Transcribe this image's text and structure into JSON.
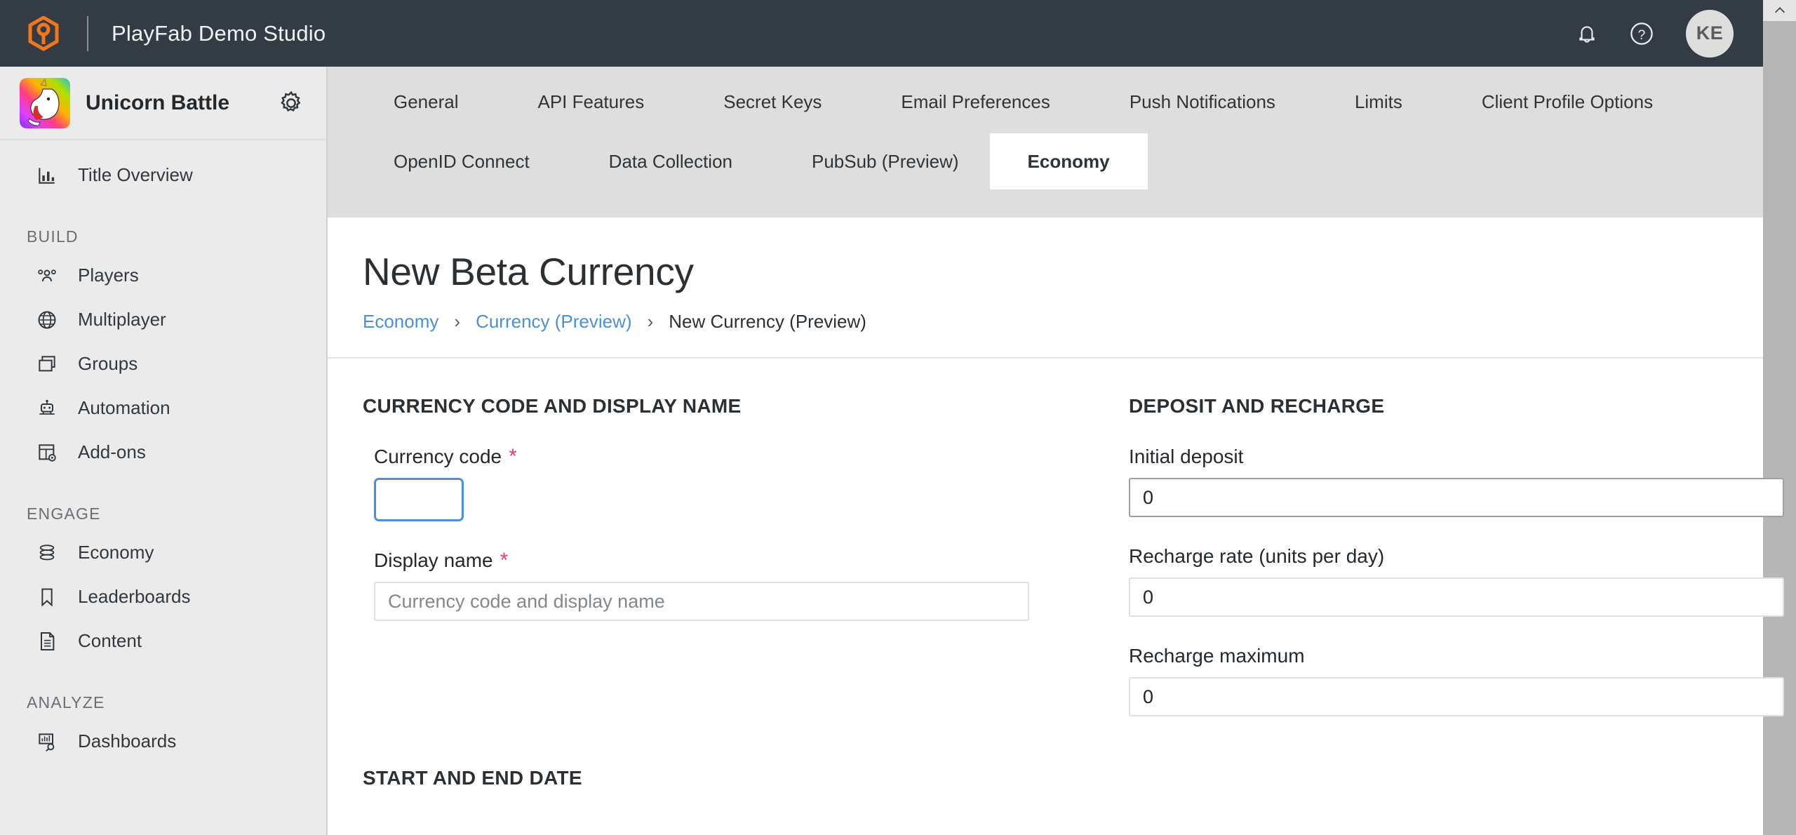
{
  "topbar": {
    "logo_icon": "playfab-hex-logo-icon",
    "studio_name": "PlayFab Demo Studio",
    "notifications_icon": "bell-icon",
    "help_icon": "help-circle-icon",
    "avatar_initials": "KE",
    "accent_orange": "#f2761b",
    "background": "#333b44"
  },
  "sidebar": {
    "title_thumbnail": "unicorn-title-thumbnail",
    "title_name": "Unicorn Battle",
    "settings_icon": "gear-icon",
    "overview": {
      "label": "Title Overview",
      "icon": "bar-chart-icon"
    },
    "groups": [
      {
        "label": "BUILD",
        "items": [
          {
            "label": "Players",
            "icon": "people-icon"
          },
          {
            "label": "Multiplayer",
            "icon": "globe-icon"
          },
          {
            "label": "Groups",
            "icon": "stacked-squares-icon"
          },
          {
            "label": "Automation",
            "icon": "robot-icon"
          },
          {
            "label": "Add-ons",
            "icon": "grid-gear-icon"
          }
        ]
      },
      {
        "label": "ENGAGE",
        "items": [
          {
            "label": "Economy",
            "icon": "coins-stack-icon"
          },
          {
            "label": "Leaderboards",
            "icon": "bookmark-icon"
          },
          {
            "label": "Content",
            "icon": "document-icon"
          }
        ]
      },
      {
        "label": "ANALYZE",
        "items": [
          {
            "label": "Dashboards",
            "icon": "chart-search-icon"
          }
        ]
      }
    ]
  },
  "tabs": {
    "row1": [
      {
        "label": "General",
        "active": false
      },
      {
        "label": "API Features",
        "active": false
      },
      {
        "label": "Secret Keys",
        "active": false
      },
      {
        "label": "Email Preferences",
        "active": false
      },
      {
        "label": "Push Notifications",
        "active": false
      },
      {
        "label": "Limits",
        "active": false
      },
      {
        "label": "Client Profile Options",
        "active": false
      }
    ],
    "row2": [
      {
        "label": "OpenID Connect",
        "active": false
      },
      {
        "label": "Data Collection",
        "active": false
      },
      {
        "label": "PubSub (Preview)",
        "active": false
      },
      {
        "label": "Economy",
        "active": true
      }
    ]
  },
  "page": {
    "title": "New Beta Currency",
    "breadcrumb": [
      {
        "label": "Economy",
        "link": true
      },
      {
        "label": "Currency (Preview)",
        "link": true
      },
      {
        "label": "New Currency (Preview)",
        "link": false
      }
    ],
    "breadcrumb_separator": "›"
  },
  "form": {
    "left_section": {
      "heading": "CURRENCY CODE AND DISPLAY NAME",
      "fields": [
        {
          "label": "Currency code",
          "required_marker": "*",
          "value": "",
          "placeholder": "",
          "focused": true
        },
        {
          "label": "Display name",
          "required_marker": "*",
          "value": "",
          "placeholder": "Currency code and display name",
          "focused": false
        }
      ]
    },
    "right_section": {
      "heading": "DEPOSIT AND RECHARGE",
      "fields": [
        {
          "label": "Initial deposit",
          "value": "0",
          "emphasized": true
        },
        {
          "label": "Recharge rate (units per day)",
          "value": "0",
          "emphasized": false
        },
        {
          "label": "Recharge maximum",
          "value": "0",
          "emphasized": false
        }
      ]
    },
    "bottom_section": {
      "heading": "START AND END DATE"
    }
  },
  "scrollbar": {
    "up_arrow_icon": "chevron-up-icon"
  },
  "colors": {
    "link_blue": "#4a90d9",
    "required_pink": "#e8416f",
    "tab_bar": "#dedede",
    "sidebar": "#ebebeb"
  }
}
